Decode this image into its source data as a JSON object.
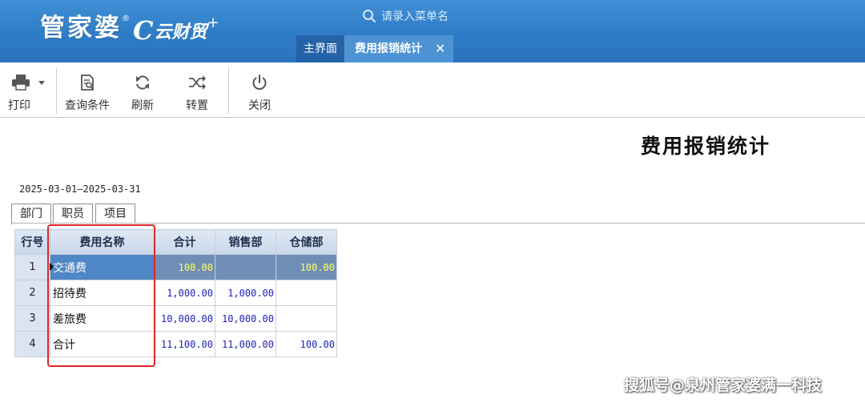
{
  "header": {
    "brand": "管家婆",
    "brand_reg": "®",
    "brand_mark": "C",
    "brand_sub": "云财贸",
    "brand_plus": "+",
    "search_placeholder": "请录入菜单名",
    "tabs": [
      {
        "label": "主界面"
      },
      {
        "label": "费用报销统计",
        "close": "✕"
      }
    ]
  },
  "toolbar": {
    "print_label": "打印",
    "query_label": "查询条件",
    "refresh_label": "刷新",
    "transpose_label": "转置",
    "close_label": "关闭"
  },
  "report": {
    "title": "费用报销统计",
    "date_range": "2025-03-01—2025-03-31",
    "subtabs": [
      "部门",
      "职员",
      "项目"
    ]
  },
  "grid": {
    "columns": [
      "行号",
      "费用名称",
      "合计",
      "销售部",
      "仓储部"
    ],
    "rows": [
      {
        "no": "1",
        "name": "交通费",
        "total": "100.00",
        "sales": "",
        "storage": "100.00"
      },
      {
        "no": "2",
        "name": "招待费",
        "total": "1,000.00",
        "sales": "1,000.00",
        "storage": ""
      },
      {
        "no": "3",
        "name": "差旅费",
        "total": "10,000.00",
        "sales": "10,000.00",
        "storage": ""
      },
      {
        "no": "4",
        "name": "合计",
        "total": "11,100.00",
        "sales": "11,000.00",
        "storage": "100.00"
      }
    ]
  },
  "watermark": "搜狐号@泉州管家婆满一科技",
  "colors": {
    "header_blue": "#2f7cc6",
    "selected_row": "#4f86c6",
    "number_blue": "#1f1fb5",
    "highlight_red": "#e0282a"
  }
}
